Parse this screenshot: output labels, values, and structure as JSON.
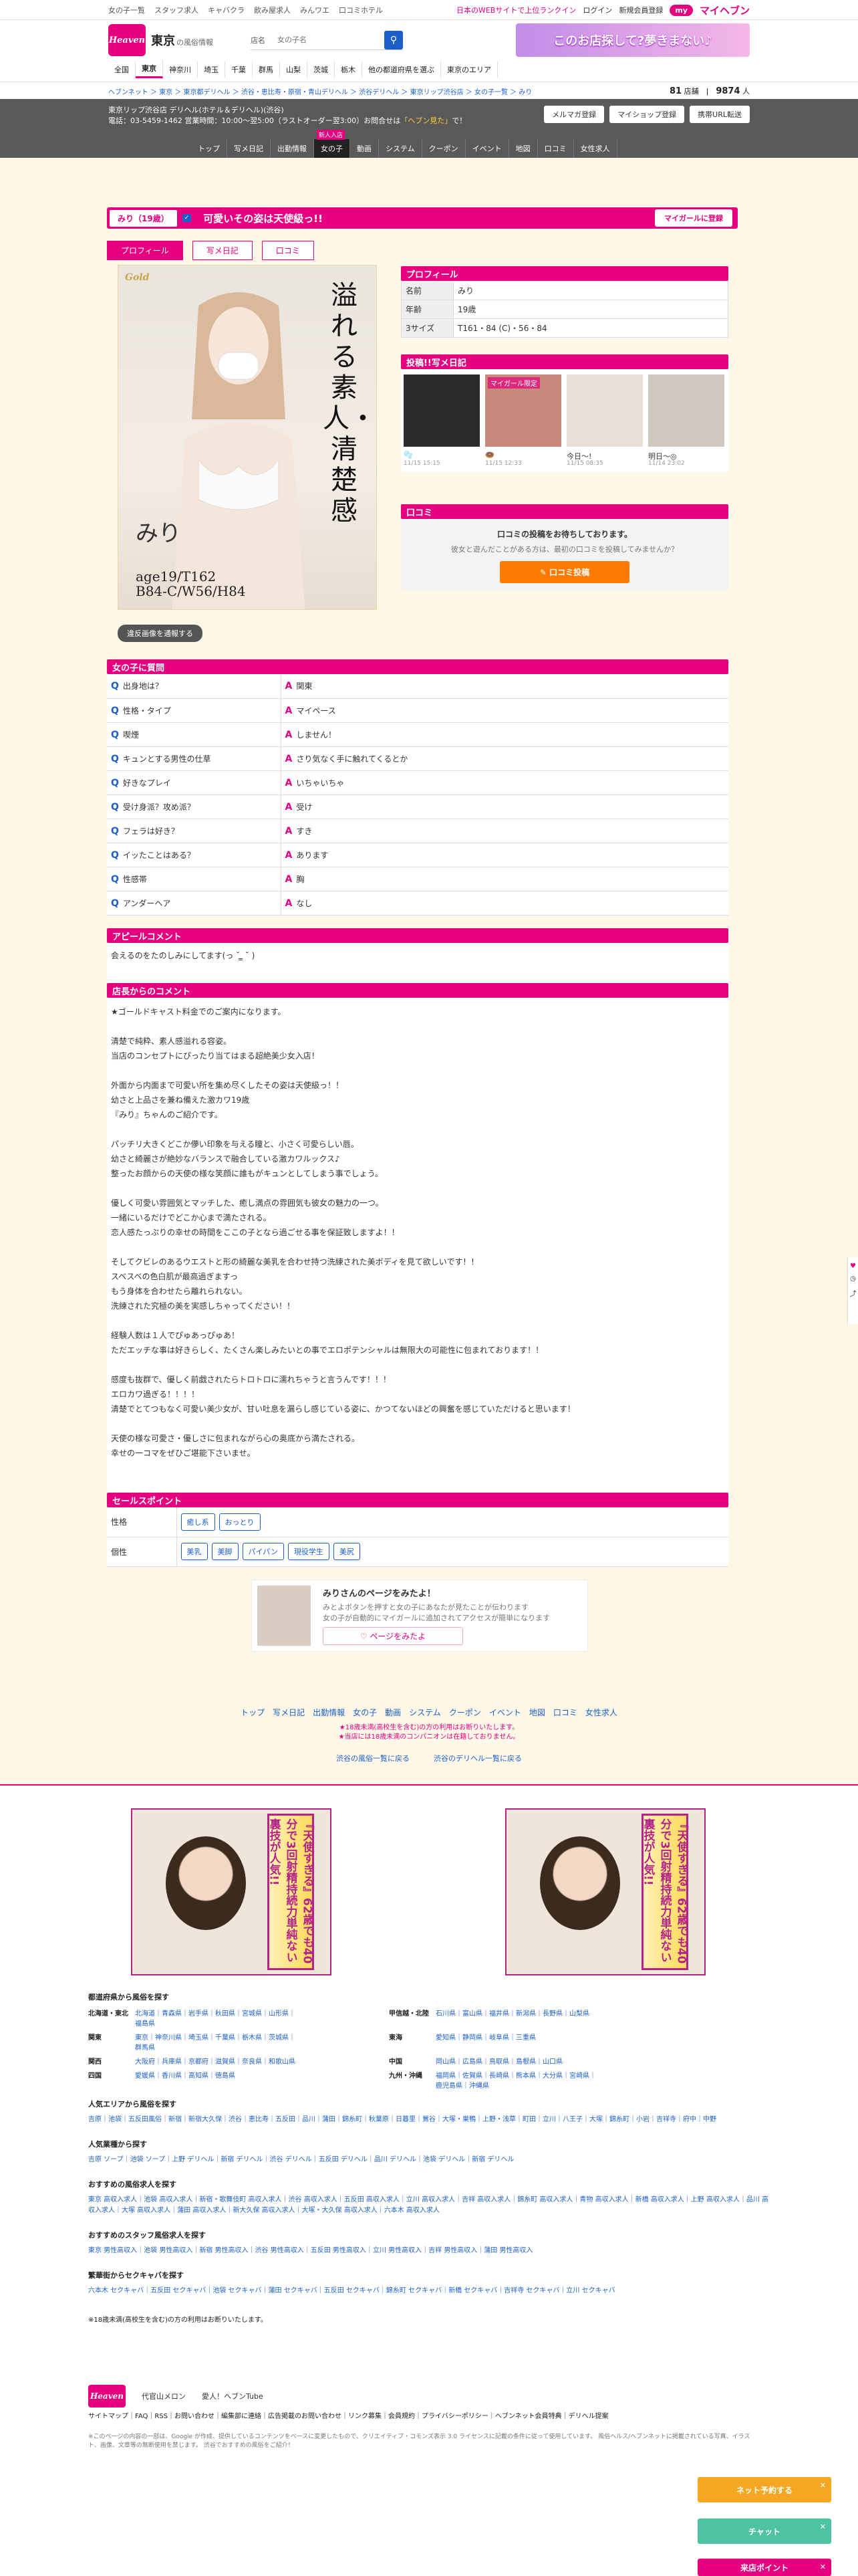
{
  "topbar": {
    "links": [
      "女の子一覧",
      "スタッフ求人",
      "キャバクラ",
      "飲み屋求人",
      "みんワエ",
      "口コミホテル"
    ],
    "right": [
      "日本のWEBサイトで上位ランクイン",
      "ログイン",
      "新規会員登録"
    ],
    "mh": "my",
    "brand": "マイヘブン"
  },
  "header": {
    "logo": "Heaven",
    "area": "東京",
    "area_sub": "の風俗情報",
    "search_label": "店名",
    "search_value": "女の子名",
    "search_icon": "search-icon",
    "banner": "このお店探して?夢きまない♪"
  },
  "prefs": [
    "全国",
    "東京",
    "神奈川",
    "埼玉",
    "千葉",
    "群馬",
    "山梨",
    "茨城",
    "栃木",
    "他の都道府県を選ぶ",
    "東京のエリア"
  ],
  "crumbs": "ヘブンネット ＞ 東京 ＞ 東京都デリヘル ＞ 渋谷・恵比寿・原宿・青山デリヘル ＞ 渋谷デリヘル ＞ 東京リップ渋谷店 ＞ 女の子一覧 ＞ みり",
  "count": {
    "n1": "81",
    "u1": "店舗",
    "n2": "9874",
    "u2": "人"
  },
  "shop": {
    "name": "東京リップ渋谷店 デリヘル(ホテル＆デリヘル)(渋谷)",
    "tel": "電話：03-5459-1462 営業時間：10:00〜翌5:00（ラストオーダー翌3:00）お問合せは",
    "hl": "「ヘブン見た」",
    "tel2": "で！",
    "btns": [
      "メルマガ登録",
      "マイショップ登録",
      "携帯URL転送"
    ],
    "tabs": [
      "トップ",
      "写メ日記",
      "出勤情報",
      "女の子",
      "動画",
      "システム",
      "クーポン",
      "イベント",
      "地図",
      "口コミ",
      "女性求人"
    ],
    "newbadge": "新人入店"
  },
  "girl": {
    "name": "みり（19歳）",
    "comment": "可愛いその姿は天使級っ!!",
    "fav": "マイガールに登録",
    "tabs": [
      "プロフィール",
      "写メ日記",
      "口コミ"
    ],
    "gold": "Gold",
    "vert": "溢れる素人・清楚感",
    "sig": "みり",
    "meas": [
      "age19/T162",
      "B84-C/W56/H84"
    ],
    "report": "違反画像を通報する"
  },
  "profile": {
    "title": "プロフィール",
    "rows": [
      [
        "名前",
        "みり"
      ],
      [
        "年齢",
        "19歳"
      ],
      [
        "3サイズ",
        "T161・84 (C)・56・84"
      ]
    ]
  },
  "diary": {
    "title": "投稿!!写メ日記",
    "items": [
      {
        "t": "🫧",
        "d": "11/15 15:15"
      },
      {
        "t": "🍩",
        "d": "11/15 12:33"
      },
      {
        "t": "今日〜!",
        "d": "11/15 08:35"
      },
      {
        "t": "明日〜◎",
        "d": "11/14 23:02"
      }
    ],
    "badge": "マイガール限定"
  },
  "kuchikomi": {
    "title": "口コミ",
    "h": "口コミの投稿をお待ちしております。",
    "p": "彼女と遊んだことがある方は、最初の口コミを投稿してみませんか？",
    "btn": "✎ 口コミ投稿"
  },
  "qa": {
    "title": "女の子に質問",
    "rows": [
      [
        "出身地は？",
        "関東"
      ],
      [
        "性格・タイプ",
        "マイペース"
      ],
      [
        "喫煙",
        "しません！"
      ],
      [
        "キュンとする男性の仕草",
        "さり気なく手に触れてくるとか"
      ],
      [
        "好きなプレイ",
        "いちゃいちゃ"
      ],
      [
        "受け身派？攻め派？",
        "受け"
      ],
      [
        "フェラは好き？",
        "すき"
      ],
      [
        "イッたことはある？",
        "あります"
      ],
      [
        "性感帯",
        "胸"
      ],
      [
        "アンダーヘア",
        "なし"
      ]
    ]
  },
  "appeal": {
    "title": "アピールコメント",
    "body": "会えるのをたのしみにしてます(っ ˘ ̳ ˘ )"
  },
  "shopcomment": {
    "title": "店長からのコメント",
    "body": "★ゴールドキャスト料金でのご案内になります。\n\n清楚で純粋、素人感溢れる容姿。\n当店のコンセプトにぴったり当てはまる超絶美少女入店！\n\n外面から内面まで可愛い所を集め尽くしたその姿は天使級っ！！\n幼さと上品さを兼ね備えた激カワ19歳\n『みり』ちゃんのご紹介です。\n\nパッチリ大きくどこか儚い印象を与える瞳と、小さく可愛らしい唇。\n幼さと綺麗さが絶妙なバランスで融合している激カワルックス♪\n整ったお顔からの天使の様な笑顔に誰もがキュンとしてしまう事でしょう。\n\n優しく可愛い雰囲気とマッチした、癒し満点の雰囲気も彼女の魅力の一つ。\n一緒にいるだけでどこか心まで満たされる。\n恋人感たっぷりの幸せの時間をここの子となら過ごせる事を保証致しますよ！！\n\nそしてクビレのあるウエストと形の綺麗な美乳を合わせ持つ洗練された美ボディを見て欲しいです！！\nスベスベの色白肌が最高過ぎますっ\nもう身体を合わせたら離れられない。\n洗練された究極の美を実感しちゃってください！！\n\n経験人数は１人でぴゅあっぴゅあ！\nただエッチな事は好きらしく、たくさん楽しみたいとの事でエロポテンシャルは無限大の可能性に包まれております！！\n\n感度も抜群で、優しく前戯されたらトロトロに濡れちゃうと言うんです！！！\nエロカワ過ぎる！！！！\n清楚でとてつもなく可愛い美少女が、甘い吐息を漏らし感じている姿に、かつてないほどの興奮を感じていただけると思います！\n\n天使の様な可愛さ・優しさに包まれながら心の奥底から満たされる。\n幸せの一コマをぜひご堪能下さいませ。"
  },
  "sales": {
    "title": "セールスポイント",
    "rows": [
      {
        "k": "性格",
        "chips": [
          "癒し系",
          "おっとり"
        ]
      },
      {
        "k": "個性",
        "chips": [
          "美乳",
          "美脚",
          "パイパン",
          "現役学生",
          "美尻"
        ]
      }
    ]
  },
  "like": {
    "title": "みりさんのページをみたよ！",
    "p1": "みとよボタンを押すと女の子にあなたが見たことが伝わります",
    "p2": "女の子が自動的にマイガールに追加されてアクセスが簡単になります",
    "btn": "♡ ページをみたよ"
  },
  "botnav": {
    "links": [
      "トップ",
      "写メ日記",
      "出勤情報",
      "女の子",
      "動画",
      "システム",
      "クーポン",
      "イベント",
      "地図",
      "口コミ",
      "女性求人"
    ],
    "n1": "★18歳未満(高校生を含む)の方の利用はお断りいたします。",
    "n2": "★当店には18歳未満のコンパニオンは在籍しておりません。",
    "b1": "渋谷の風俗一覧に戻る",
    "b2": "渋谷のデリヘル一覧に戻る"
  },
  "ad": {
    "text": "『天使すぎる』62歳でも40分で3回射精持続力単純ない裏技が人気!!"
  },
  "links": {
    "pref_title": "都道府県から風俗を探す",
    "regions": [
      [
        "北海道・東北",
        "北海道｜青森県｜岩手県｜秋田県｜宮城県｜山形県｜福島県",
        "甲信越・北陸",
        "石川県｜富山県｜福井県｜新潟県｜長野県｜山梨県"
      ],
      [
        "関東",
        "東京｜神奈川県｜埼玉県｜千葉県｜栃木県｜茨城県｜群馬県",
        "東海",
        "愛知県｜静岡県｜岐阜県｜三重県"
      ],
      [
        "関西",
        "大阪府｜兵庫県｜京都府｜滋賀県｜奈良県｜和歌山県",
        "中国",
        "岡山県｜広島県｜鳥取県｜島根県｜山口県"
      ],
      [
        "四国",
        "愛媛県｜香川県｜高知県｜徳島県",
        "九州・沖縄",
        "福岡県｜佐賀県｜長崎県｜熊本県｜大分県｜宮崎県｜鹿児島県｜沖縄県"
      ]
    ],
    "blocks": [
      {
        "h": "人気エリアから風俗を探す",
        "t": "吉原｜池袋｜五反田風俗｜新宿｜新宿大久保｜渋谷｜恵比寿｜五反田｜品川｜蒲田｜錦糸町｜秋葉原｜日暮里｜鶯谷｜大塚・巣鴨｜上野・浅草｜町田｜立川｜八王子｜大塚｜錦糸町｜小岩｜吉祥寺｜府中｜中野"
      },
      {
        "h": "人気業種から探す",
        "t": "吉原 ソープ｜池袋 ソープ｜上野 デリヘル｜新宿 デリヘル｜渋谷 デリヘル｜五反田 デリヘル｜品川 デリヘル｜池袋 デリヘル｜新宿 デリヘル"
      },
      {
        "h": "おすすめの風俗求人を探す",
        "t": "東京 高収入求人｜池袋 高収入求人｜新宿・歌舞伎町 高収入求人｜渋谷 高収入求人｜五反田 高収入求人｜立川 高収入求人｜吉祥 高収入求人｜錦糸町 高収入求人｜青物 高収入求人｜新橋 高収入求人｜上野 高収入求人｜品川 高収入求人｜大塚 高収入求人｜蒲田 高収入求人｜新大久保 高収入求人｜大塚・大久保 高収入求人｜六本木 高収入求人"
      },
      {
        "h": "おすすめのスタッフ風俗求人を探す",
        "t": "東京 男性高収入｜池袋 男性高収入｜新宿 男性高収入｜渋谷 男性高収入｜五反田 男性高収入｜立川 男性高収入｜吉祥 男性高収入｜蒲田 男性高収入"
      },
      {
        "h": "繁華街からセクキャバを探す",
        "t": "六本木 セクキャバ｜五反田 セクキャバ｜池袋 セクキャバ｜蒲田 セクキャバ｜五反田 セクキャバ｜錦糸町 セクキャバ｜新橋 セクキャバ｜吉祥寺 セクキャバ｜立川 セクキャバ"
      }
    ],
    "ageNote": "※18歳未満(高校生を含む)の方の利用はお断りいたします。"
  },
  "footer": {
    "logo": "Heaven",
    "partners": [
      "代官山メロン",
      "愛人！ヘブンTube"
    ],
    "links": "サイトマップ｜FAQ｜RSS｜お問い合わせ｜編集部に連絡｜広告掲載のお問い合わせ｜リンク募集｜会員規約｜プライバシーポリシー｜ヘブンネット会員特典｜デリヘル提案",
    "note": "※このページの内容の一部は、Google が作成、提供しているコンテンツをベースに変更したもので、クリエイティブ・コモンズ表示 3.0 ライセンスに記載の条件に従って使用しています。 風俗ヘルス/ヘブンネットに掲載されている写真、イラスト、画像、文章等の無断使用を禁じます。 渋谷でおすすめの風俗をご紹介！"
  },
  "fabs": [
    {
      "label": "ネット予約する",
      "color": "#f5a623"
    },
    {
      "label": "チャット",
      "color": "#4fc3a1"
    },
    {
      "label": "来店ポイント",
      "color": "#e4007f"
    }
  ]
}
